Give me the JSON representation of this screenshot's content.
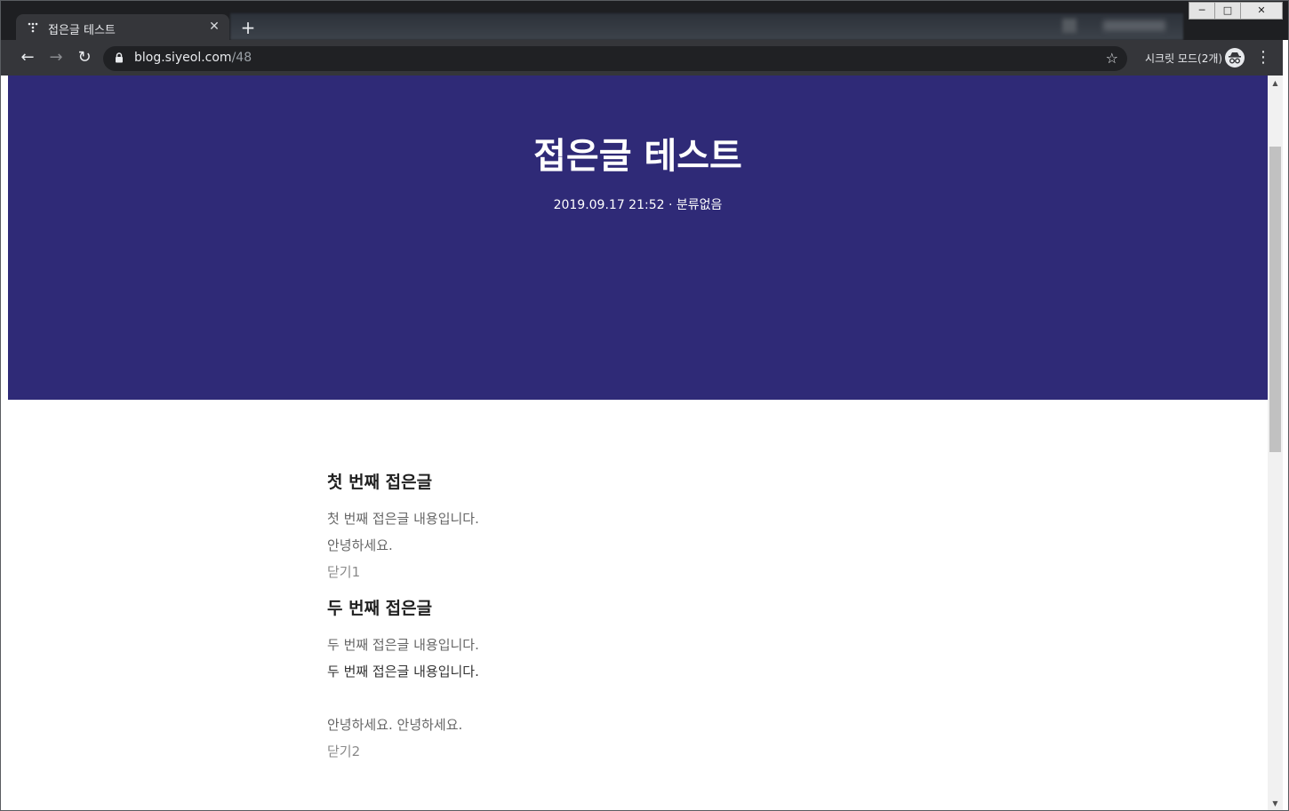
{
  "browser": {
    "tab_title": "접은글 테스트",
    "tab_close": "✕",
    "new_tab": "+",
    "url_host": "blog.siyeol.com",
    "url_path": "/48",
    "incognito_label": "시크릿 모드(2개)",
    "back_icon": "←",
    "forward_icon": "→",
    "reload_icon": "↻",
    "star_icon": "☆",
    "menu_icon": "⋮",
    "window_minimize": "─",
    "window_maximize": "□",
    "window_close": "✕"
  },
  "post": {
    "title": "접은글 테스트",
    "date": "2019.09.17 21:52",
    "separator": "·",
    "category": "분류없음"
  },
  "sections": [
    {
      "heading": "첫 번째 접은글",
      "lines": [
        "첫 번째 접은글 내용입니다.",
        "안녕하세요."
      ],
      "close_label": "닫기1"
    },
    {
      "heading": "두 번째 접은글",
      "lines": [
        "두 번째 접은글 내용입니다.",
        "두 번째 접은글 내용입니다.",
        "",
        "안녕하세요. 안녕하세요."
      ],
      "close_label": "닫기2"
    }
  ],
  "colors": {
    "hero_bg": "#2f2a77",
    "chrome_dark": "#35363a"
  }
}
